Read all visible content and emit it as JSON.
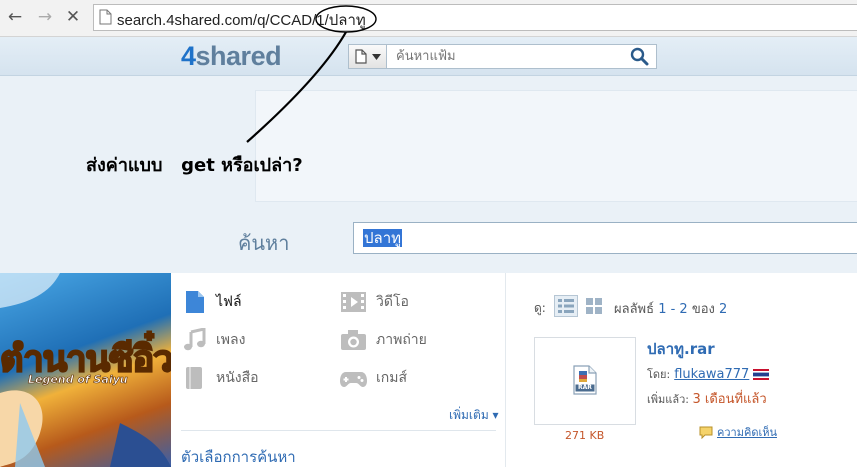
{
  "browser": {
    "url": "search.4shared.com/q/CCAD/1/ปลาทู",
    "back_icon": "←",
    "forward_icon": "→",
    "stop_icon": "✕"
  },
  "header": {
    "logo_num": "4",
    "logo_text": "shared",
    "search_placeholder": "ค้นหาแฟ้ม"
  },
  "annotation": {
    "text": "ส่งค่าแบบ   get หรือเปล่า?"
  },
  "main_search": {
    "label": "ค้นหา",
    "value": "ปลาทู"
  },
  "banner": {
    "title": "ตำนานซีอิ๋ว",
    "subtitle": "Legend of Saiyu"
  },
  "categories": {
    "items": [
      {
        "label": "ไฟล์",
        "icon": "file-icon"
      },
      {
        "label": "วิดีโอ",
        "icon": "video-icon"
      },
      {
        "label": "เพลง",
        "icon": "music-icon"
      },
      {
        "label": "ภาพถ่าย",
        "icon": "camera-icon"
      },
      {
        "label": "หนังสือ",
        "icon": "book-icon"
      },
      {
        "label": "เกมส์",
        "icon": "gamepad-icon"
      }
    ],
    "more": "เพิ่มเติม ▾",
    "search_options": "ตัวเลือกการค้นหา"
  },
  "results": {
    "view_label": "ดู:",
    "count_prefix": "ผลลัพธ์",
    "count_range": "1 - 2",
    "count_of": "ของ",
    "count_total": "2",
    "file": {
      "name": "ปลาทู.rar",
      "size": "271 KB",
      "by_label": "โดย:",
      "uploader": "flukawa777",
      "added_label": "เพิ่มแล้ว:",
      "added_value": "3 เดือนที่แล้ว",
      "comments": "ความคิดเห็น",
      "type_badge": "RAR"
    }
  },
  "colors": {
    "brand_blue": "#1e72c9",
    "link_blue": "#2f6bb3",
    "accent_orange": "#c5562a"
  }
}
